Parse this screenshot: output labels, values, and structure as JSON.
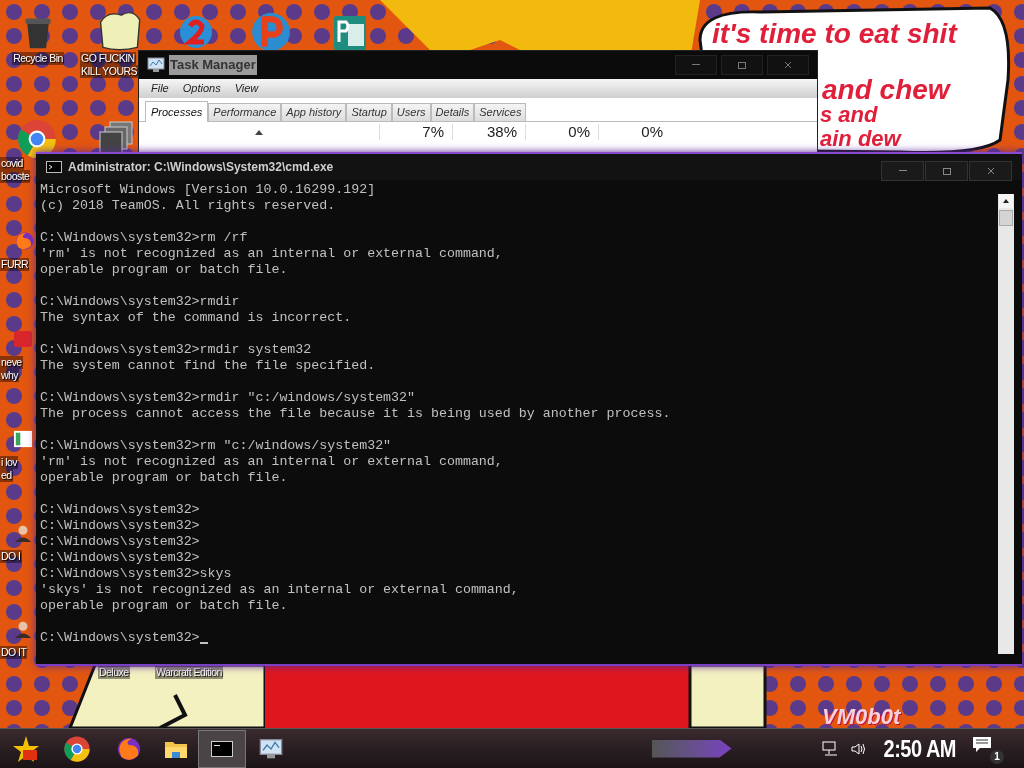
{
  "desktop": {
    "icons": [
      {
        "kind": "bin",
        "label": [
          "Recycle Bin"
        ]
      },
      {
        "kind": "sack",
        "label": [
          "GO FUCKIN",
          "KILL YOURS"
        ]
      },
      {
        "kind": "two"
      },
      {
        "kind": "letter"
      },
      {
        "kind": "doc"
      },
      {
        "kind": "chrome"
      },
      {
        "kind": "stack"
      },
      {
        "kind": "none",
        "label": [
          "covid",
          "booste"
        ]
      },
      {
        "kind": "fox",
        "label": [
          "FURR"
        ]
      },
      {
        "kind": "red",
        "label": [
          "neve",
          "why"
        ]
      },
      {
        "kind": "green",
        "label": [
          "i lov",
          "ed"
        ]
      },
      {
        "kind": "person",
        "label": [
          "DO I"
        ]
      },
      {
        "kind": "person",
        "label": [
          "DO IT"
        ]
      },
      {
        "kind": "none",
        "label": [
          "Deluxe"
        ]
      },
      {
        "kind": "none",
        "label": [
          "Warcraft Edition"
        ]
      }
    ],
    "speech_bubble": [
      "it's time to eat shit",
      "and chew",
      "s and",
      "ain dew"
    ],
    "wallpaper_text": "VM0b0t"
  },
  "task_manager": {
    "title": "Task Manager",
    "menu": [
      "File",
      "Options",
      "View"
    ],
    "tabs": [
      {
        "label": "Processes",
        "selected": true
      },
      {
        "label": "Performance",
        "selected": false
      },
      {
        "label": "App history",
        "selected": false
      },
      {
        "label": "Startup",
        "selected": false
      },
      {
        "label": "Users",
        "selected": false
      },
      {
        "label": "Details",
        "selected": false
      },
      {
        "label": "Services",
        "selected": false
      }
    ],
    "column_values": [
      "7%",
      "38%",
      "0%",
      "0%"
    ]
  },
  "console": {
    "title": "Administrator: C:\\Windows\\System32\\cmd.exe",
    "blocks": [
      [
        "Microsoft Windows [Version 10.0.16299.192]",
        "(c) 2018 TeamOS. All rights reserved."
      ],
      [
        "C:\\Windows\\system32>rm /rf",
        "'rm' is not recognized as an internal or external command,",
        "operable program or batch file."
      ],
      [
        "C:\\Windows\\system32>rmdir",
        "The syntax of the command is incorrect."
      ],
      [
        "C:\\Windows\\system32>rmdir system32",
        "The system cannot find the file specified."
      ],
      [
        "C:\\Windows\\system32>rmdir \"c:/windows/system32\"",
        "The process cannot access the file because it is being used by another process."
      ],
      [
        "C:\\Windows\\system32>rm \"c:/windows/system32\"",
        "'rm' is not recognized as an internal or external command,",
        "operable program or batch file."
      ],
      [
        "C:\\Windows\\system32>",
        "C:\\Windows\\system32>",
        "C:\\Windows\\system32>",
        "C:\\Windows\\system32>",
        "C:\\Windows\\system32>skys",
        "'skys' is not recognized as an internal or external command,",
        "operable program or batch file."
      ],
      [
        "C:\\Windows\\system32>"
      ]
    ],
    "cursor": true
  },
  "taskbar": {
    "apps": [
      {
        "kind": "start",
        "selected": false
      },
      {
        "kind": "chrome",
        "selected": false
      },
      {
        "kind": "fox",
        "selected": false
      },
      {
        "kind": "folder",
        "selected": false
      },
      {
        "kind": "console",
        "selected": true
      },
      {
        "kind": "monitor",
        "selected": false
      }
    ],
    "time": "2:50 AM",
    "notification_count": "1"
  }
}
